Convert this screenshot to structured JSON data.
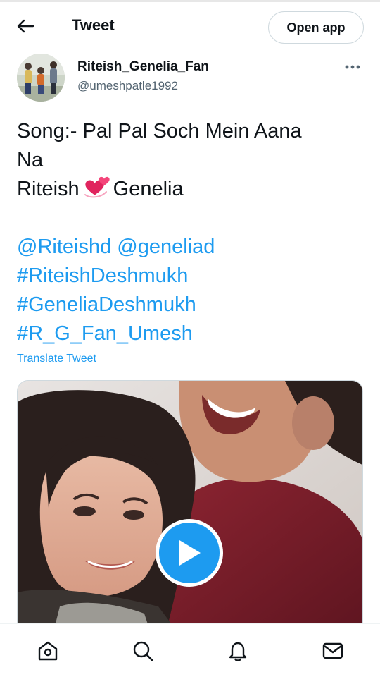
{
  "header": {
    "back_icon": "arrow-left-icon",
    "title": "Tweet",
    "open_app_label": "Open app"
  },
  "tweet": {
    "author_name": "Riteish_Genelia_Fan",
    "author_handle": "@umeshpatle1992",
    "more_icon": "more-horizontal-icon",
    "text_line1": "Song:- Pal Pal Soch Mein Aana",
    "text_line2": "Na",
    "text_line3_before": "Riteish",
    "text_line3_emoji": "two-hearts-emoji",
    "text_line3_after": "Genelia",
    "mention1": "@Riteishd",
    "mention2": "@geneliad",
    "hashtag1": "#RiteishDeshmukh",
    "hashtag2": "#GeneliaDeshmukh",
    "hashtag3": "#R_G_Fan_Umesh",
    "translate_label": "Translate Tweet",
    "media_type": "video",
    "play_icon": "play-icon"
  },
  "bottom_nav": {
    "items": [
      {
        "icon": "home-icon"
      },
      {
        "icon": "search-icon"
      },
      {
        "icon": "notifications-bell-icon"
      },
      {
        "icon": "messages-envelope-icon"
      }
    ]
  },
  "colors": {
    "accent": "#1d9bf0",
    "text_primary": "#0f1419",
    "text_secondary": "#536471",
    "border": "#cfd9de"
  }
}
